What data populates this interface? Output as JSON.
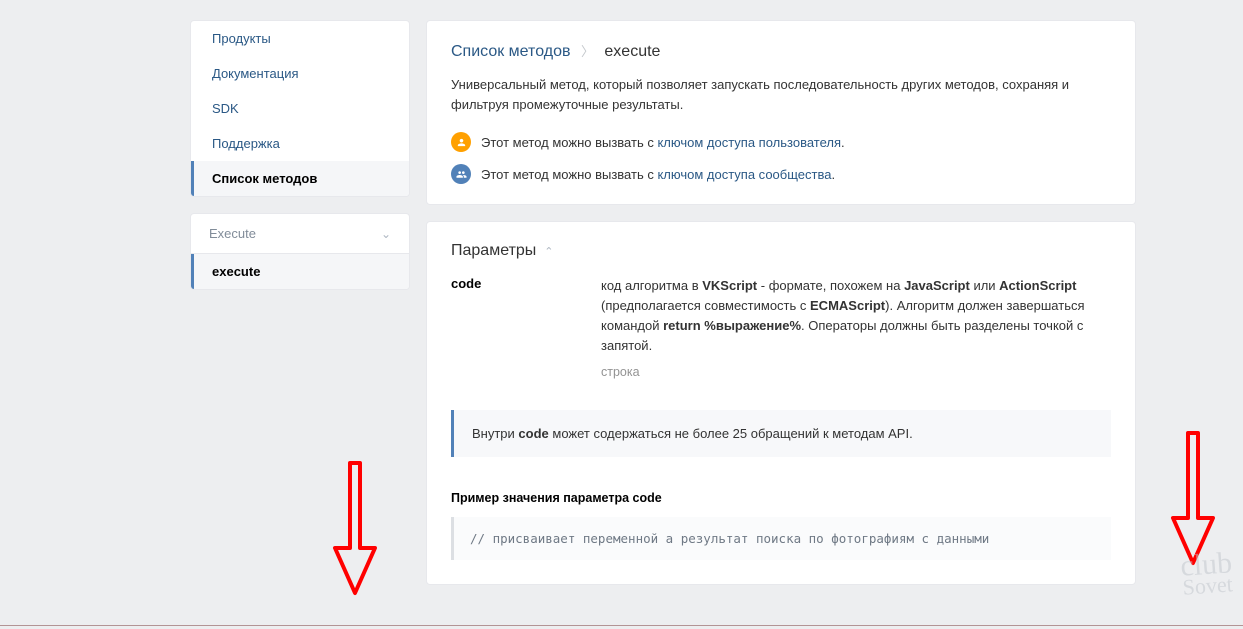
{
  "sidebar": {
    "items": [
      {
        "label": "Продукты"
      },
      {
        "label": "Документация"
      },
      {
        "label": "SDK"
      },
      {
        "label": "Поддержка"
      },
      {
        "label": "Список методов"
      }
    ],
    "dropdown_label": "Execute",
    "sub_item": "execute"
  },
  "breadcrumb": {
    "root": "Список методов",
    "leaf": "execute"
  },
  "description": "Универсальный метод, который позволяет запускать последовательность других методов, сохраняя и фильтруя промежуточные результаты.",
  "access": {
    "user_prefix": "Этот метод можно вызвать с ",
    "user_link": "ключом доступа пользователя",
    "community_prefix": "Этот метод можно вызвать с ",
    "community_link": "ключом доступа сообщества"
  },
  "params_title": "Параметры",
  "param": {
    "name": "code",
    "desc_parts": {
      "p1": "код алгоритма в ",
      "b1": "VKScript",
      "p2": " - формате, похожем на ",
      "b2": "JavaScript",
      "p3": " или ",
      "b3": "ActionScript",
      "p4": " (предполагается совместимость с ",
      "b4": "ECMAScript",
      "p5": "). Алгоритм должен завершаться командой ",
      "b5": "return %выражение%",
      "p6": ". Операторы должны быть разделены точкой с запятой."
    },
    "type": "строка"
  },
  "note": {
    "p1": "Внутри ",
    "b1": "code",
    "p2": " может содержаться не более 25 обращений к методам API."
  },
  "example_title": "Пример значения параметра code",
  "code_sample": "// присваивает переменной a результат поиска по фотографиям с данными",
  "watermark": {
    "line1": "club",
    "line2": "Sovet"
  }
}
